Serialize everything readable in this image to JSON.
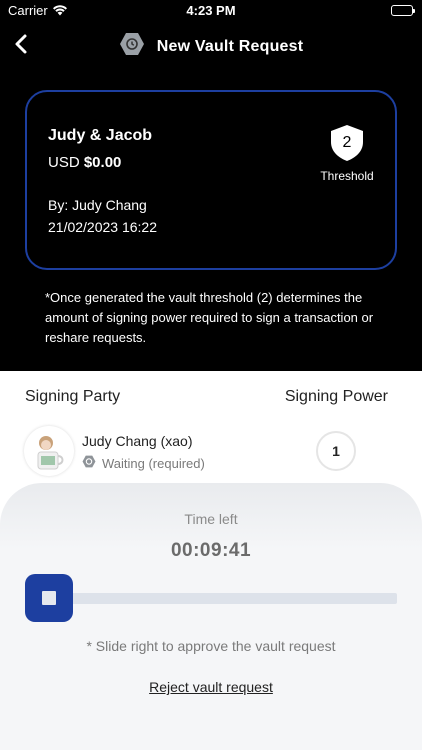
{
  "status_bar": {
    "carrier": "Carrier",
    "time": "4:23 PM"
  },
  "nav": {
    "title": "New Vault Request"
  },
  "vault": {
    "name": "Judy & Jacob",
    "currency": "USD",
    "amount": "$0.00",
    "threshold": "2",
    "threshold_label": "Threshold",
    "by": "By: Judy Chang",
    "date": "21/02/2023 16:22"
  },
  "note": "*Once generated the vault threshold (2) determines the amount of signing power required to sign a transaction or reshare requests.",
  "signers": {
    "header_party": "Signing Party",
    "header_power": "Signing Power",
    "items": [
      {
        "name": "Judy Chang (xao)",
        "status": "Waiting (required)",
        "power": "1"
      }
    ]
  },
  "approval": {
    "time_label": "Time left",
    "time_value": "00:09:41",
    "progress": 0,
    "hint": "* Slide right to approve the vault request",
    "reject_label": "Reject vault request"
  },
  "colors": {
    "accent": "#1d3fa0",
    "background": "#000000"
  }
}
